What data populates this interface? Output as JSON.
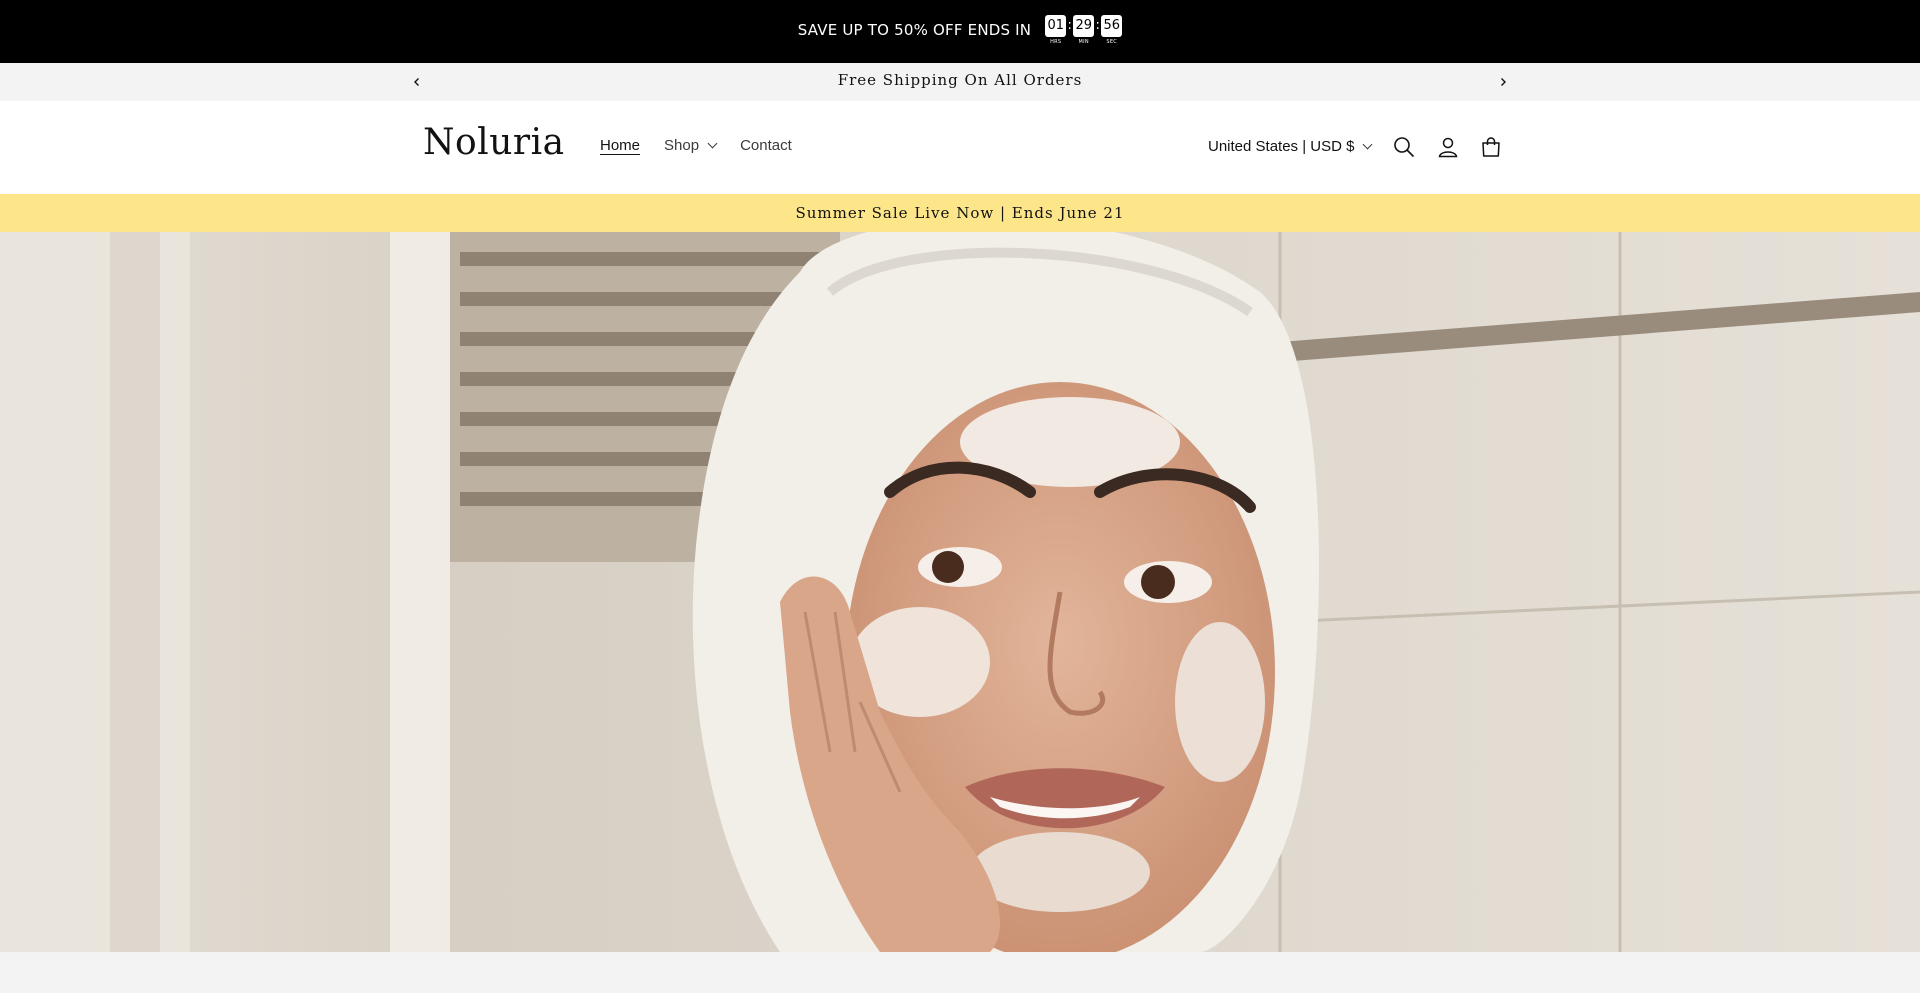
{
  "promo": {
    "text": "SAVE UP TO 50% OFF ENDS IN",
    "timer": [
      {
        "value": "01",
        "label": "HRS"
      },
      {
        "value": "29",
        "label": "MIN"
      },
      {
        "value": "56",
        "label": "SEC"
      }
    ],
    "separator": ":"
  },
  "announcement": {
    "text": "Free Shipping On All Orders",
    "prev_icon": "chevron-left-icon",
    "next_icon": "chevron-right-icon"
  },
  "header": {
    "logo": "Noluria",
    "nav": [
      {
        "label": "Home",
        "active": true
      },
      {
        "label": "Shop",
        "has_dropdown": true
      },
      {
        "label": "Contact"
      }
    ],
    "locale": "United States | USD $",
    "icons": [
      "search-icon",
      "account-icon",
      "cart-icon"
    ]
  },
  "sale_banner": {
    "text": "Summer Sale Live Now | Ends June 21",
    "color": "#fde68a"
  },
  "hero": {
    "image": "woman-with-towel-applying-face-cream"
  }
}
